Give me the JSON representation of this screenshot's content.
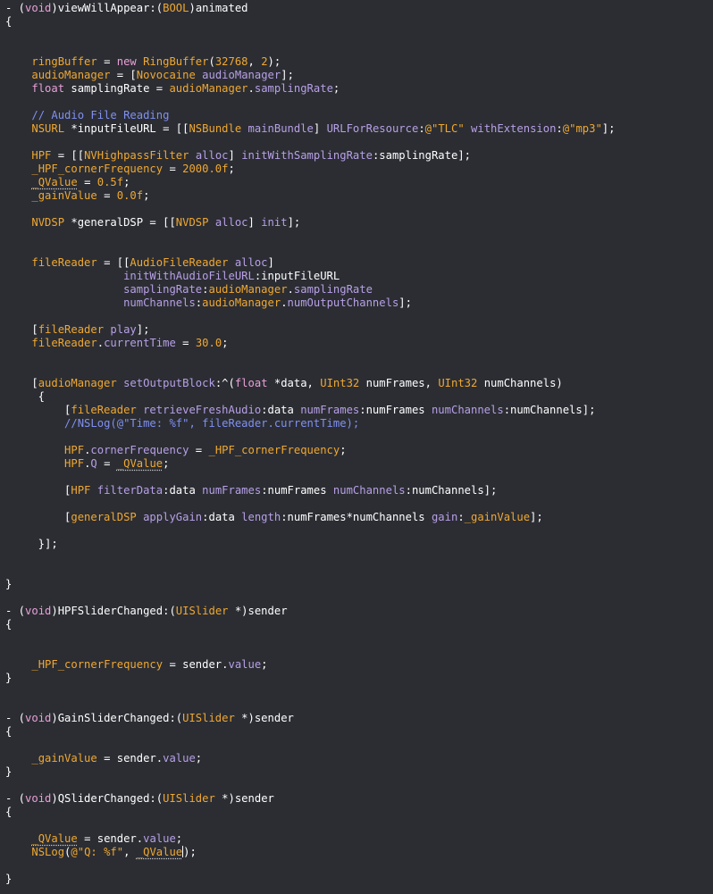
{
  "editor": {
    "language": "objective-c",
    "colors": {
      "background": "#2b2d33",
      "plain": "#ffffff",
      "keyword": "#e9a0d6",
      "type": "#f0a830",
      "method": "#b8a0e6",
      "comment": "#8090f0"
    },
    "lines": [
      [
        [
          "p",
          "- ("
        ],
        [
          "kw",
          "void"
        ],
        [
          "p",
          ")viewWillAppear:("
        ],
        [
          "type",
          "BOOL"
        ],
        [
          "p",
          ")animated"
        ]
      ],
      [
        [
          "p",
          "{"
        ]
      ],
      [],
      [],
      [
        [
          "p",
          "    "
        ],
        [
          "ivar",
          "ringBuffer"
        ],
        [
          "p",
          " = "
        ],
        [
          "kw",
          "new"
        ],
        [
          "p",
          " "
        ],
        [
          "class",
          "RingBuffer"
        ],
        [
          "p",
          "("
        ],
        [
          "num",
          "32768"
        ],
        [
          "p",
          ", "
        ],
        [
          "num",
          "2"
        ],
        [
          "p",
          ");"
        ]
      ],
      [
        [
          "p",
          "    "
        ],
        [
          "ivar",
          "audioManager"
        ],
        [
          "p",
          " = ["
        ],
        [
          "class",
          "Novocaine"
        ],
        [
          "p",
          " "
        ],
        [
          "method",
          "audioManager"
        ],
        [
          "p",
          "];"
        ]
      ],
      [
        [
          "p",
          "    "
        ],
        [
          "kw",
          "float"
        ],
        [
          "p",
          " samplingRate = "
        ],
        [
          "ivar",
          "audioManager"
        ],
        [
          "p",
          "."
        ],
        [
          "prop",
          "samplingRate"
        ],
        [
          "p",
          ";"
        ]
      ],
      [],
      [
        [
          "p",
          "    "
        ],
        [
          "comment",
          "// Audio File Reading"
        ]
      ],
      [
        [
          "p",
          "    "
        ],
        [
          "type",
          "NSURL"
        ],
        [
          "p",
          " *inputFileURL = [["
        ],
        [
          "class",
          "NSBundle"
        ],
        [
          "p",
          " "
        ],
        [
          "method",
          "mainBundle"
        ],
        [
          "p",
          "] "
        ],
        [
          "method",
          "URLForResource"
        ],
        [
          "p",
          ":"
        ],
        [
          "str",
          "@\"TLC\""
        ],
        [
          "p",
          " "
        ],
        [
          "method",
          "withExtension"
        ],
        [
          "p",
          ":"
        ],
        [
          "str",
          "@\"mp3\""
        ],
        [
          "p",
          "];"
        ]
      ],
      [],
      [
        [
          "p",
          "    "
        ],
        [
          "ivar",
          "HPF"
        ],
        [
          "p",
          " = [["
        ],
        [
          "class",
          "NVHighpassFilter"
        ],
        [
          "p",
          " "
        ],
        [
          "method",
          "alloc"
        ],
        [
          "p",
          "] "
        ],
        [
          "method",
          "initWithSamplingRate"
        ],
        [
          "p",
          ":samplingRate];"
        ]
      ],
      [
        [
          "p",
          "    "
        ],
        [
          "ivar",
          "_HPF_cornerFrequency"
        ],
        [
          "p",
          " = "
        ],
        [
          "num",
          "2000.0f"
        ],
        [
          "p",
          ";"
        ]
      ],
      [
        [
          "p",
          "    "
        ],
        [
          "ivar_sq",
          "_QValue"
        ],
        [
          "p",
          " = "
        ],
        [
          "num",
          "0.5f"
        ],
        [
          "p",
          ";"
        ]
      ],
      [
        [
          "p",
          "    "
        ],
        [
          "ivar",
          "_gainValue"
        ],
        [
          "p",
          " = "
        ],
        [
          "num",
          "0.0f"
        ],
        [
          "p",
          ";"
        ]
      ],
      [],
      [
        [
          "p",
          "    "
        ],
        [
          "type",
          "NVDSP"
        ],
        [
          "p",
          " *generalDSP = [["
        ],
        [
          "class",
          "NVDSP"
        ],
        [
          "p",
          " "
        ],
        [
          "method",
          "alloc"
        ],
        [
          "p",
          "] "
        ],
        [
          "method",
          "init"
        ],
        [
          "p",
          "];"
        ]
      ],
      [],
      [],
      [
        [
          "p",
          "    "
        ],
        [
          "ivar",
          "fileReader"
        ],
        [
          "p",
          " = [["
        ],
        [
          "class",
          "AudioFileReader"
        ],
        [
          "p",
          " "
        ],
        [
          "method",
          "alloc"
        ],
        [
          "p",
          "]"
        ]
      ],
      [
        [
          "p",
          "                  "
        ],
        [
          "method",
          "initWithAudioFileURL"
        ],
        [
          "p",
          ":inputFileURL"
        ]
      ],
      [
        [
          "p",
          "                  "
        ],
        [
          "method",
          "samplingRate"
        ],
        [
          "p",
          ":"
        ],
        [
          "ivar",
          "audioManager"
        ],
        [
          "p",
          "."
        ],
        [
          "prop",
          "samplingRate"
        ]
      ],
      [
        [
          "p",
          "                  "
        ],
        [
          "method",
          "numChannels"
        ],
        [
          "p",
          ":"
        ],
        [
          "ivar",
          "audioManager"
        ],
        [
          "p",
          "."
        ],
        [
          "prop",
          "numOutputChannels"
        ],
        [
          "p",
          "];"
        ]
      ],
      [],
      [
        [
          "p",
          "    ["
        ],
        [
          "ivar",
          "fileReader"
        ],
        [
          "p",
          " "
        ],
        [
          "method",
          "play"
        ],
        [
          "p",
          "];"
        ]
      ],
      [
        [
          "p",
          "    "
        ],
        [
          "ivar",
          "fileReader"
        ],
        [
          "p",
          "."
        ],
        [
          "prop",
          "currentTime"
        ],
        [
          "p",
          " = "
        ],
        [
          "num",
          "30.0"
        ],
        [
          "p",
          ";"
        ]
      ],
      [],
      [],
      [
        [
          "p",
          "    ["
        ],
        [
          "ivar",
          "audioManager"
        ],
        [
          "p",
          " "
        ],
        [
          "method",
          "setOutputBlock"
        ],
        [
          "p",
          ":^("
        ],
        [
          "kw",
          "float"
        ],
        [
          "p",
          " *data, "
        ],
        [
          "type",
          "UInt32"
        ],
        [
          "p",
          " numFrames, "
        ],
        [
          "type",
          "UInt32"
        ],
        [
          "p",
          " numChannels)"
        ]
      ],
      [
        [
          "p",
          "     {"
        ]
      ],
      [
        [
          "p",
          "         ["
        ],
        [
          "ivar",
          "fileReader"
        ],
        [
          "p",
          " "
        ],
        [
          "method",
          "retrieveFreshAudio"
        ],
        [
          "p",
          ":data "
        ],
        [
          "method",
          "numFrames"
        ],
        [
          "p",
          ":numFrames "
        ],
        [
          "method",
          "numChannels"
        ],
        [
          "p",
          ":numChannels];"
        ]
      ],
      [
        [
          "p",
          "         "
        ],
        [
          "comment",
          "//NSLog(@\"Time: %f\", fileReader.currentTime);"
        ]
      ],
      [],
      [
        [
          "p",
          "         "
        ],
        [
          "ivar",
          "HPF"
        ],
        [
          "p",
          "."
        ],
        [
          "prop",
          "cornerFrequency"
        ],
        [
          "p",
          " = "
        ],
        [
          "ivar",
          "_HPF_cornerFrequency"
        ],
        [
          "p",
          ";"
        ]
      ],
      [
        [
          "p",
          "         "
        ],
        [
          "ivar",
          "HPF"
        ],
        [
          "p",
          "."
        ],
        [
          "prop",
          "Q"
        ],
        [
          "p",
          " = "
        ],
        [
          "ivar_sq",
          "_QValue"
        ],
        [
          "p",
          ";"
        ]
      ],
      [],
      [
        [
          "p",
          "         ["
        ],
        [
          "ivar",
          "HPF"
        ],
        [
          "p",
          " "
        ],
        [
          "method",
          "filterData"
        ],
        [
          "p",
          ":data "
        ],
        [
          "method",
          "numFrames"
        ],
        [
          "p",
          ":numFrames "
        ],
        [
          "method",
          "numChannels"
        ],
        [
          "p",
          ":numChannels];"
        ]
      ],
      [],
      [
        [
          "p",
          "         ["
        ],
        [
          "ivar",
          "generalDSP"
        ],
        [
          "p",
          " "
        ],
        [
          "method",
          "applyGain"
        ],
        [
          "p",
          ":data "
        ],
        [
          "method",
          "length"
        ],
        [
          "p",
          ":numFrames*numChannels "
        ],
        [
          "method",
          "gain"
        ],
        [
          "p",
          ":"
        ],
        [
          "ivar",
          "_gainValue"
        ],
        [
          "p",
          "];"
        ]
      ],
      [],
      [
        [
          "p",
          "     }];"
        ]
      ],
      [],
      [],
      [
        [
          "p",
          "}"
        ]
      ],
      [],
      [
        [
          "p",
          "- ("
        ],
        [
          "kw",
          "void"
        ],
        [
          "p",
          ")HPFSliderChanged:("
        ],
        [
          "type",
          "UISlider"
        ],
        [
          "p",
          " *)sender"
        ]
      ],
      [
        [
          "p",
          "{"
        ]
      ],
      [],
      [],
      [
        [
          "p",
          "    "
        ],
        [
          "ivar",
          "_HPF_cornerFrequency"
        ],
        [
          "p",
          " = sender."
        ],
        [
          "prop",
          "value"
        ],
        [
          "p",
          ";"
        ]
      ],
      [
        [
          "p",
          "}"
        ]
      ],
      [],
      [],
      [
        [
          "p",
          "- ("
        ],
        [
          "kw",
          "void"
        ],
        [
          "p",
          ")GainSliderChanged:("
        ],
        [
          "type",
          "UISlider"
        ],
        [
          "p",
          " *)sender"
        ]
      ],
      [
        [
          "p",
          "{"
        ]
      ],
      [],
      [
        [
          "p",
          "    "
        ],
        [
          "ivar",
          "_gainValue"
        ],
        [
          "p",
          " = sender."
        ],
        [
          "prop",
          "value"
        ],
        [
          "p",
          ";"
        ]
      ],
      [
        [
          "p",
          "}"
        ]
      ],
      [],
      [
        [
          "p",
          "- ("
        ],
        [
          "kw",
          "void"
        ],
        [
          "p",
          ")QSliderChanged:("
        ],
        [
          "type",
          "UISlider"
        ],
        [
          "p",
          " *)sender"
        ]
      ],
      [
        [
          "p",
          "{"
        ]
      ],
      [],
      [
        [
          "p",
          "    "
        ],
        [
          "ivar_sq",
          "_QValue"
        ],
        [
          "p",
          " = sender."
        ],
        [
          "prop",
          "value"
        ],
        [
          "p",
          ";"
        ]
      ],
      [
        [
          "p",
          "    "
        ],
        [
          "type",
          "NSLog"
        ],
        [
          "p",
          "("
        ],
        [
          "str",
          "@\"Q: %f\""
        ],
        [
          "p",
          ", "
        ],
        [
          "ivar_sq",
          "_QValue"
        ],
        [
          "cursor",
          ""
        ],
        [
          "p",
          ");"
        ]
      ],
      [],
      [
        [
          "p",
          "}"
        ]
      ]
    ]
  }
}
